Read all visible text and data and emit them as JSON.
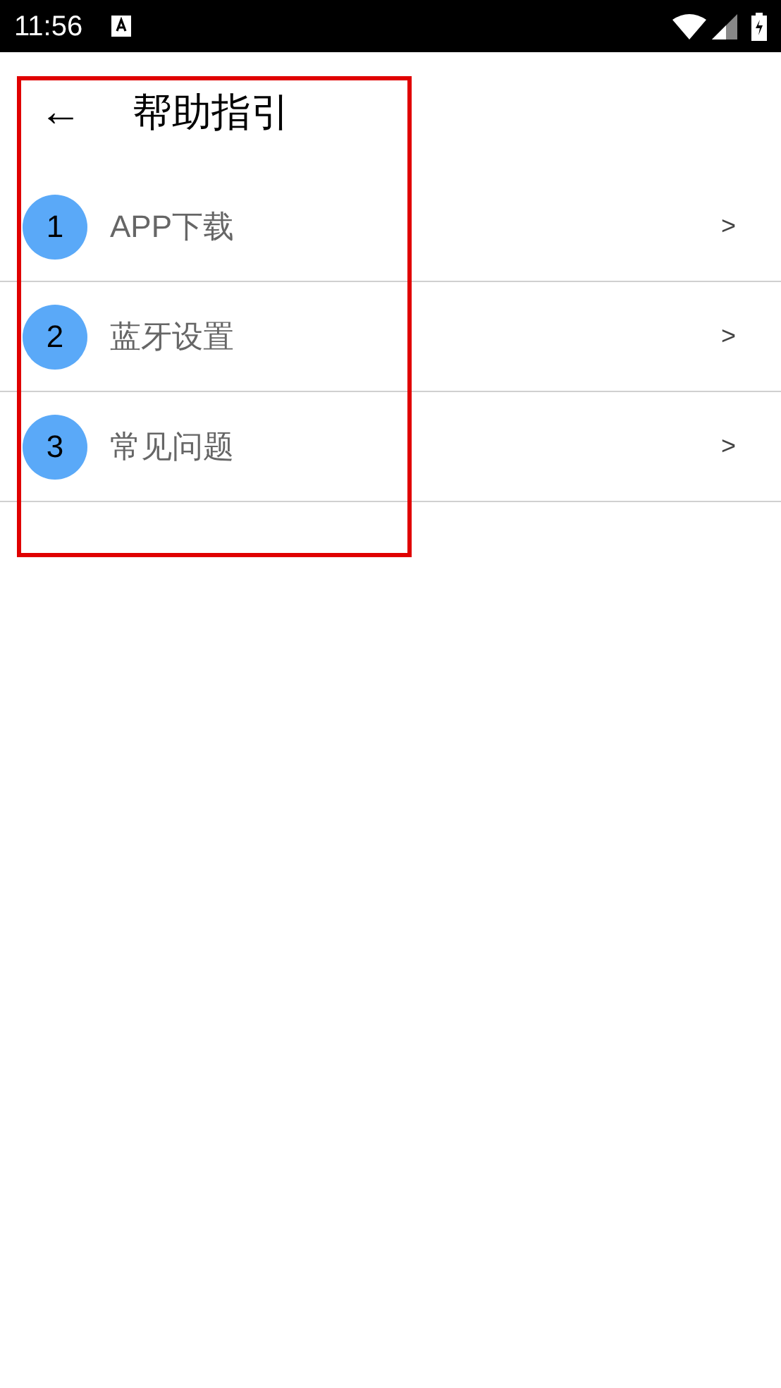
{
  "status_bar": {
    "time": "11:56"
  },
  "header": {
    "back": "←",
    "title": "帮助指引"
  },
  "items": [
    {
      "number": "1",
      "label": "APP下载",
      "chevron": ">"
    },
    {
      "number": "2",
      "label": "蓝牙设置",
      "chevron": ">"
    },
    {
      "number": "3",
      "label": "常见问题",
      "chevron": ">"
    }
  ]
}
